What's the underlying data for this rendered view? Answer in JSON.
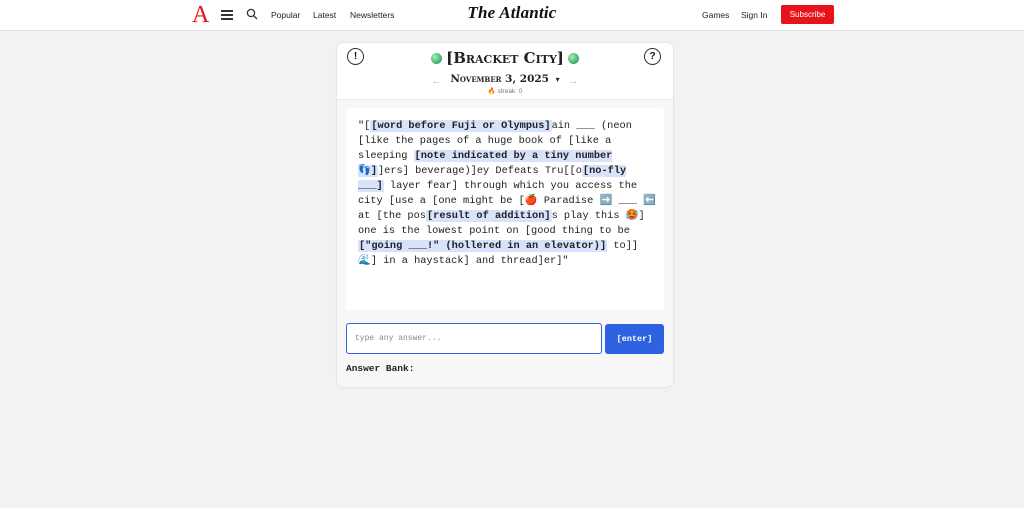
{
  "nav": {
    "logo": "A",
    "brand": "The Atlantic",
    "links": [
      "Popular",
      "Latest",
      "Newsletters"
    ],
    "right_links": [
      "Games",
      "Sign In"
    ],
    "subscribe": "Subscribe",
    "colors": {
      "brand_red": "#e7131a"
    },
    "icons": [
      "menu-icon",
      "search-icon"
    ]
  },
  "game": {
    "title": "[Bracket City]",
    "help_left": "!",
    "help_right": "?",
    "date": "November 3, 2025",
    "date_caret": "▾",
    "prev_arrow": "←",
    "next_arrow": "→",
    "streak": "streak: 0",
    "flame": "🔥",
    "puzzle_segments": [
      {
        "t": "\"[",
        "h": false
      },
      {
        "t": "[word before Fuji or Olympus]",
        "h": true
      },
      {
        "t": "ain ___ (neon [like the pages of a huge book of [like a sleeping ",
        "h": false
      },
      {
        "t": "[note indicated by a tiny number 👣]",
        "h": true
      },
      {
        "t": "]ers] beverage)]ey Defeats Tru[[o",
        "h": false
      },
      {
        "t": "[no-fly ___]",
        "h": true
      },
      {
        "t": " layer fear] through which you access the city [use a [one might be [🍎 Paradise ➡️ ___ ⬅️ at [the pos",
        "h": false
      },
      {
        "t": "[result of addition]",
        "h": true
      },
      {
        "t": "s play this 🥵] one is the lowest point on [good thing to be ",
        "h": false
      },
      {
        "t": "[\"going ___!\" (hollered in an elevator)]",
        "h": true
      },
      {
        "t": " to]] 🌊] in a haystack] and thread]er]\"",
        "h": false
      }
    ],
    "input_placeholder": "type any answer...",
    "enter_label": "[enter]",
    "answer_bank_label": "Answer Bank:",
    "colors": {
      "accent": "#2f62e0",
      "highlight": "#d8e2fb"
    }
  }
}
